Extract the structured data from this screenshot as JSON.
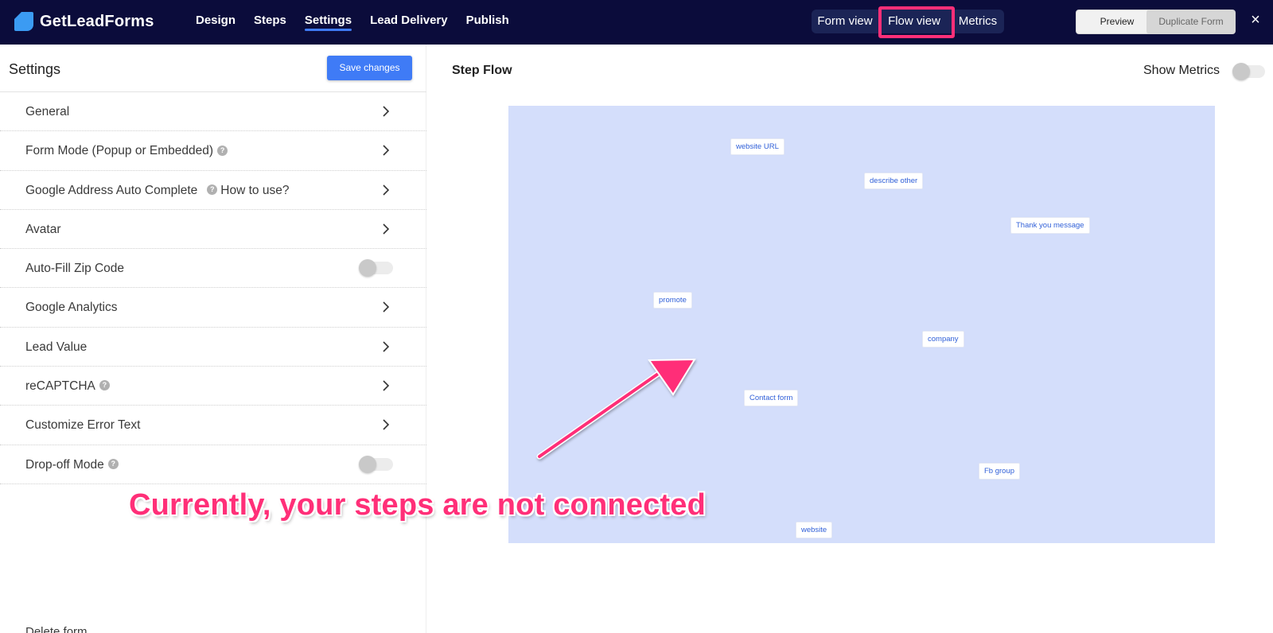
{
  "brand": {
    "name": "GetLeadForms"
  },
  "nav": {
    "items": [
      {
        "label": "Design",
        "active": false
      },
      {
        "label": "Steps",
        "active": false
      },
      {
        "label": "Settings",
        "active": true
      },
      {
        "label": "Lead Delivery",
        "active": false
      },
      {
        "label": "Publish",
        "active": false
      }
    ]
  },
  "views": {
    "form": "Form view",
    "flow": "Flow view",
    "metrics": "Metrics",
    "active": "flow"
  },
  "toolbar": {
    "preview": "Preview",
    "duplicate": "Duplicate Form",
    "close": "×"
  },
  "settings": {
    "title": "Settings",
    "save_label": "Save changes",
    "help_link": "How to use?",
    "items": [
      {
        "label": "General",
        "control": "chevron"
      },
      {
        "label": "Form Mode (Popup or Embedded)",
        "control": "chevron",
        "help": true
      },
      {
        "label": "Google Address Auto Complete",
        "control": "chevron",
        "help": true
      },
      {
        "label": "Avatar",
        "control": "chevron"
      },
      {
        "label": "Auto-Fill Zip Code",
        "control": "toggle",
        "value": false
      },
      {
        "label": "Google Analytics",
        "control": "chevron"
      },
      {
        "label": "Lead Value",
        "control": "chevron"
      },
      {
        "label": "reCAPTCHA",
        "control": "chevron",
        "help": true
      },
      {
        "label": "Customize Error Text",
        "control": "chevron"
      },
      {
        "label": "Drop-off Mode",
        "control": "toggle",
        "value": false,
        "help": true
      }
    ],
    "delete_label": "Delete form"
  },
  "flow": {
    "title": "Step Flow",
    "show_metrics_label": "Show Metrics",
    "show_metrics": false,
    "canvas_color": "#d4defb",
    "nodes": [
      {
        "label": "website URL"
      },
      {
        "label": "describe other"
      },
      {
        "label": "Thank you message"
      },
      {
        "label": "promote"
      },
      {
        "label": "company"
      },
      {
        "label": "Contact form"
      },
      {
        "label": "Fb group"
      },
      {
        "label": "website"
      }
    ]
  },
  "annotation": {
    "text": "Currently, your steps are not connected",
    "color": "#ff2f78"
  },
  "colors": {
    "topbar": "#0b0c3b",
    "accent": "#3f7bf6",
    "highlight": "#ff2f78"
  }
}
